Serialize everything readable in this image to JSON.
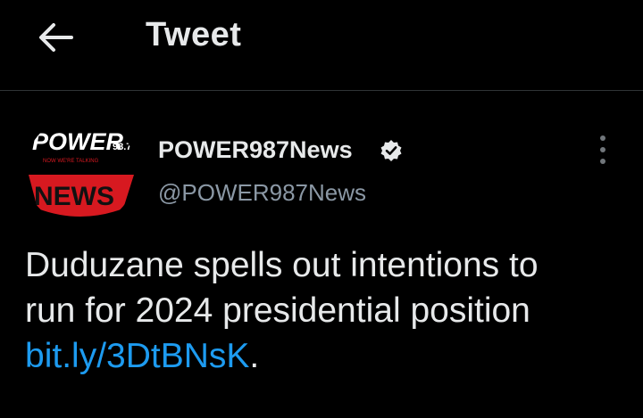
{
  "header": {
    "title": "Tweet"
  },
  "avatar": {
    "logo_top": "POWER",
    "logo_freq": "98.7",
    "logo_tagline": "NOW WE'RE TALKING",
    "logo_bottom": "NEWS"
  },
  "author": {
    "display_name": "POWER987News",
    "handle": "@POWER987News"
  },
  "tweet": {
    "text_line_1": "Duduzane spells out intentions to",
    "text_line_2": "run for 2024 presidential position",
    "link": "bit.ly/3DtBNsK",
    "trailing": "."
  },
  "colors": {
    "background": "#000000",
    "text": "#e7e9ea",
    "secondary": "#8b98a5",
    "link": "#1d9bf0",
    "brand_red": "#d71920"
  },
  "icons": {
    "back": "arrow-left-icon",
    "verified": "verified-badge-icon",
    "more": "more-vertical-icon"
  }
}
